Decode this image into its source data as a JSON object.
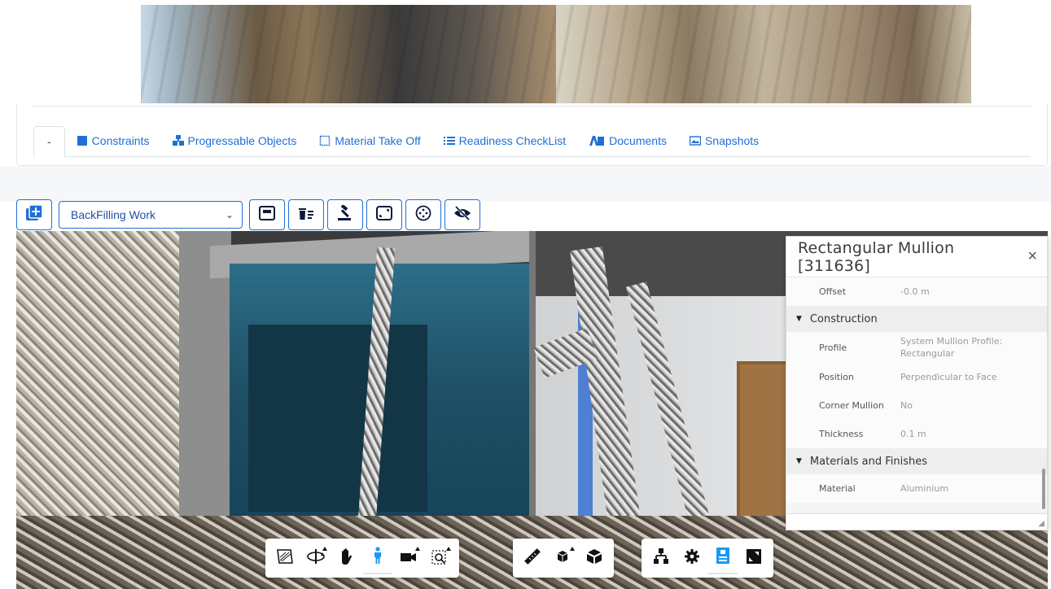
{
  "tabs": [
    {
      "label": "-",
      "icon": "none",
      "active": true
    },
    {
      "label": "Constraints",
      "icon": "square-icon",
      "active": false
    },
    {
      "label": "Progressable Objects",
      "icon": "cubes-icon",
      "active": false
    },
    {
      "label": "Material Take Off",
      "icon": "take-off-icon",
      "active": false
    },
    {
      "label": "Readiness CheckList",
      "icon": "list-icon",
      "active": false
    },
    {
      "label": "Documents",
      "icon": "documents-icon",
      "active": false
    },
    {
      "label": "Snapshots",
      "icon": "image-icon",
      "active": false
    }
  ],
  "toolbar": {
    "selected_activity": "BackFilling Work"
  },
  "properties_panel": {
    "title": "Rectangular Mullion [311636]",
    "close_symbol": "×",
    "rows_top": [
      {
        "key": "Offset",
        "value": "-0.0 m"
      }
    ],
    "sections": [
      {
        "name": "Construction",
        "rows": [
          {
            "key": "Profile",
            "value": "System Mullion Profile: Rectangular"
          },
          {
            "key": "Position",
            "value": "Perpendicular to Face"
          },
          {
            "key": "Corner Mullion",
            "value": "No"
          },
          {
            "key": "Thickness",
            "value": "0.1 m"
          }
        ]
      },
      {
        "name": "Materials and Finishes",
        "rows": [
          {
            "key": "Material",
            "value": "Aluminium"
          }
        ]
      }
    ]
  },
  "viewer_toolbar": {
    "groups": [
      [
        "section-analysis-icon",
        "orbit-icon",
        "pan-icon",
        "first-person-icon",
        "camera-icon",
        "fit-to-view-icon"
      ],
      [
        "measure-icon",
        "explode-model-icon",
        "model-browser-icon"
      ],
      [
        "structure-tree-icon",
        "settings-icon",
        "properties-icon",
        "fullscreen-icon"
      ]
    ],
    "active": "first-person-icon"
  },
  "colors": {
    "accent": "#1f6fd6",
    "active_icon": "#1a9bf0"
  }
}
